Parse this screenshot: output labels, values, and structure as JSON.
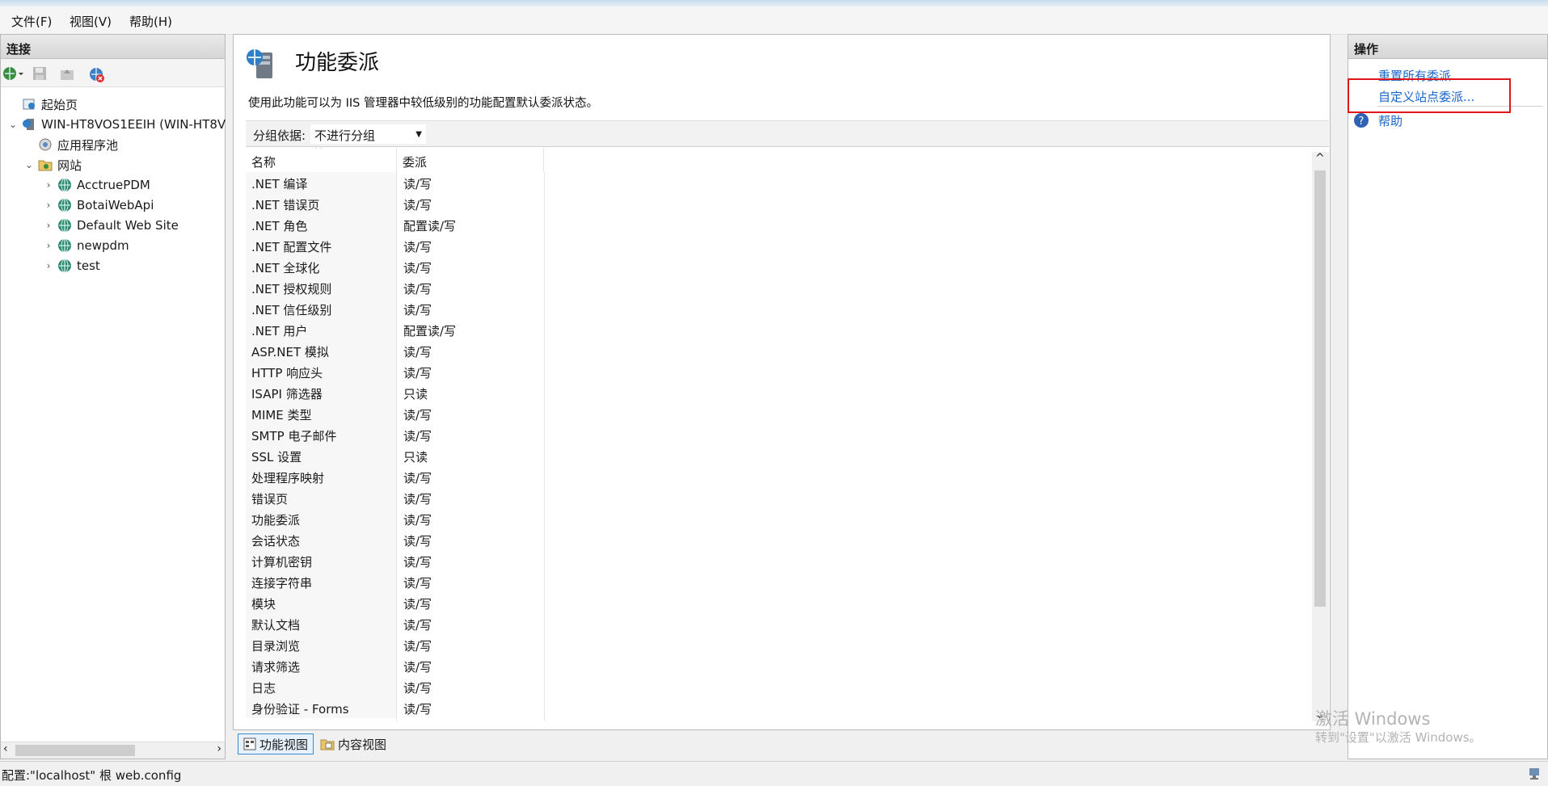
{
  "menu": [
    "文件(F)",
    "视图(V)",
    "帮助(H)"
  ],
  "connections": {
    "title": "连接",
    "tree": [
      {
        "label": "起始页",
        "level": 0,
        "expander": "",
        "icon": "start-page-icon"
      },
      {
        "label": "WIN-HT8VOS1EEIH (WIN-HT8V",
        "level": 0,
        "expander": "⌄",
        "icon": "server-icon"
      },
      {
        "label": "应用程序池",
        "level": 1,
        "expander": "",
        "icon": "app-pool-icon"
      },
      {
        "label": "网站",
        "level": 1,
        "expander": "⌄",
        "icon": "sites-folder-icon"
      },
      {
        "label": "AcctruePDM",
        "level": 2,
        "expander": "›",
        "icon": "globe-icon"
      },
      {
        "label": "BotaiWebApi",
        "level": 2,
        "expander": "›",
        "icon": "globe-icon"
      },
      {
        "label": "Default Web Site",
        "level": 2,
        "expander": "›",
        "icon": "globe-icon"
      },
      {
        "label": "newpdm",
        "level": 2,
        "expander": "›",
        "icon": "globe-icon"
      },
      {
        "label": "test",
        "level": 2,
        "expander": "›",
        "icon": "globe-icon"
      }
    ]
  },
  "feature": {
    "title": "功能委派",
    "description": "使用此功能可以为 IIS 管理器中较低级别的功能配置默认委派状态。",
    "group_by_label": "分组依据:",
    "group_by_value": "不进行分组",
    "columns": [
      "名称",
      "委派"
    ],
    "rows": [
      {
        "name": ".NET 编译",
        "delegation": "读/写"
      },
      {
        "name": ".NET 错误页",
        "delegation": "读/写"
      },
      {
        "name": ".NET 角色",
        "delegation": "配置读/写"
      },
      {
        "name": ".NET 配置文件",
        "delegation": "读/写"
      },
      {
        "name": ".NET 全球化",
        "delegation": "读/写"
      },
      {
        "name": ".NET 授权规则",
        "delegation": "读/写"
      },
      {
        "name": ".NET 信任级别",
        "delegation": "读/写"
      },
      {
        "name": ".NET 用户",
        "delegation": "配置读/写"
      },
      {
        "name": "ASP.NET 模拟",
        "delegation": "读/写"
      },
      {
        "name": "HTTP 响应头",
        "delegation": "读/写"
      },
      {
        "name": "ISAPI 筛选器",
        "delegation": "只读"
      },
      {
        "name": "MIME 类型",
        "delegation": "读/写"
      },
      {
        "name": "SMTP 电子邮件",
        "delegation": "读/写"
      },
      {
        "name": "SSL 设置",
        "delegation": "只读"
      },
      {
        "name": "处理程序映射",
        "delegation": "读/写"
      },
      {
        "name": "错误页",
        "delegation": "读/写"
      },
      {
        "name": "功能委派",
        "delegation": "读/写"
      },
      {
        "name": "会话状态",
        "delegation": "读/写"
      },
      {
        "name": "计算机密钥",
        "delegation": "读/写"
      },
      {
        "name": "连接字符串",
        "delegation": "读/写"
      },
      {
        "name": "模块",
        "delegation": "读/写"
      },
      {
        "name": "默认文档",
        "delegation": "读/写"
      },
      {
        "name": "目录浏览",
        "delegation": "读/写"
      },
      {
        "name": "请求筛选",
        "delegation": "读/写"
      },
      {
        "name": "日志",
        "delegation": "读/写"
      },
      {
        "name": "身份验证 - Forms",
        "delegation": "读/写"
      }
    ],
    "view_tabs": [
      "功能视图",
      "内容视图"
    ]
  },
  "actions": {
    "title": "操作",
    "items": [
      "重置所有委派",
      "自定义站点委派...",
      "帮助"
    ]
  },
  "watermark": {
    "line1": "激活 Windows",
    "line2": "转到\"设置\"以激活 Windows。"
  },
  "status": {
    "text": "配置:\"localhost\" 根 web.config"
  },
  "colors": {
    "link": "#1a66c9",
    "highlight": "#e3141c"
  }
}
